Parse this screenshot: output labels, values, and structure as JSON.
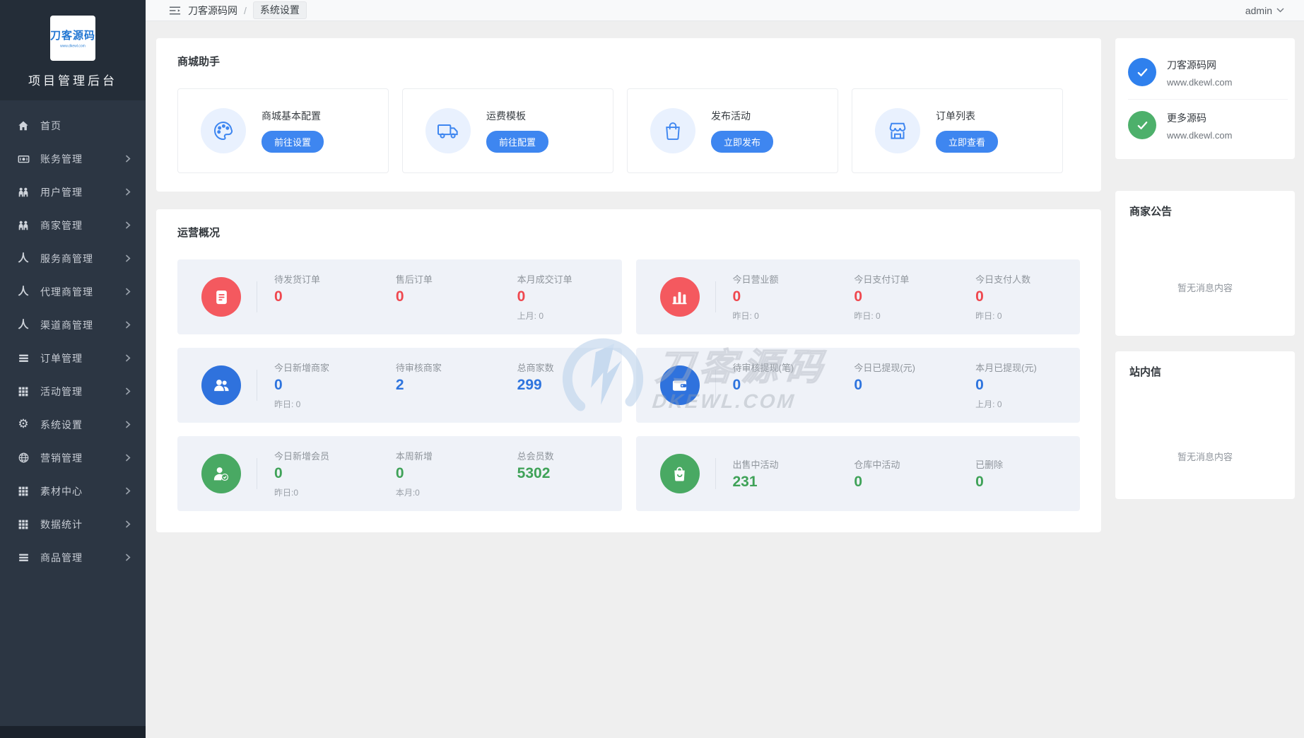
{
  "app": {
    "logo_title": "刀客源码",
    "logo_subtitle": "www.dkewl.com",
    "sidebar_title": "项目管理后台"
  },
  "topbar": {
    "breadcrumb": [
      "刀客源码网",
      "系统设置"
    ],
    "separator": "/",
    "user": "admin"
  },
  "sidebar": {
    "items": [
      {
        "id": "home",
        "label": "首页",
        "icon": "home-icon",
        "children": false
      },
      {
        "id": "finance",
        "label": "账务管理",
        "icon": "banknote-icon",
        "children": true
      },
      {
        "id": "users",
        "label": "用户管理",
        "icon": "users-icon",
        "children": true
      },
      {
        "id": "merchants",
        "label": "商家管理",
        "icon": "users-icon",
        "children": true
      },
      {
        "id": "service-providers",
        "label": "服务商管理",
        "icon": "person-icon",
        "children": true
      },
      {
        "id": "agents",
        "label": "代理商管理",
        "icon": "person-icon",
        "children": true
      },
      {
        "id": "channel-providers",
        "label": "渠道商管理",
        "icon": "person-icon",
        "children": true
      },
      {
        "id": "orders",
        "label": "订单管理",
        "icon": "list-icon",
        "children": true
      },
      {
        "id": "activities",
        "label": "活动管理",
        "icon": "grid-icon",
        "children": true
      },
      {
        "id": "system-settings",
        "label": "系统设置",
        "icon": "gear-icon",
        "children": true
      },
      {
        "id": "marketing",
        "label": "营销管理",
        "icon": "globe-icon",
        "children": true
      },
      {
        "id": "materials",
        "label": "素材中心",
        "icon": "grid-icon",
        "children": true
      },
      {
        "id": "statistics",
        "label": "数据统计",
        "icon": "grid-icon",
        "children": true
      },
      {
        "id": "goods",
        "label": "商品管理",
        "icon": "list-icon",
        "children": true
      }
    ]
  },
  "shop_helper": {
    "title": "商城助手",
    "items": [
      {
        "id": "shop-config",
        "label": "商城基本配置",
        "button": "前往设置",
        "icon": "palette-icon"
      },
      {
        "id": "freight-template",
        "label": "运费模板",
        "button": "前往配置",
        "icon": "truck-icon"
      },
      {
        "id": "publish-activity",
        "label": "发布活动",
        "button": "立即发布",
        "icon": "bag-icon"
      },
      {
        "id": "order-list",
        "label": "订单列表",
        "button": "立即查看",
        "icon": "store-icon"
      }
    ]
  },
  "overview": {
    "title": "运营概况",
    "panels": [
      {
        "id": "pending-orders",
        "accent": "red",
        "icon": "doc-icon",
        "stats": [
          {
            "label": "待发货订单",
            "value": "0"
          },
          {
            "label": "售后订单",
            "value": "0"
          },
          {
            "label": "本月成交订单",
            "value": "0",
            "sub": "上月: 0"
          }
        ]
      },
      {
        "id": "today-revenue",
        "accent": "red",
        "icon": "chart-icon",
        "stats": [
          {
            "label": "今日营业额",
            "value": "0",
            "sub": "昨日: 0"
          },
          {
            "label": "今日支付订单",
            "value": "0",
            "sub": "昨日: 0"
          },
          {
            "label": "今日支付人数",
            "value": "0",
            "sub": "昨日: 0"
          }
        ]
      },
      {
        "id": "merchant-stats",
        "accent": "blue",
        "icon": "users-white-icon",
        "stats": [
          {
            "label": "今日新增商家",
            "value": "0",
            "sub": "昨日: 0"
          },
          {
            "label": "待审核商家",
            "value": "2"
          },
          {
            "label": "总商家数",
            "value": "299"
          }
        ]
      },
      {
        "id": "withdraw-stats",
        "accent": "blue",
        "icon": "wallet-icon",
        "stats": [
          {
            "label": "待审核提现(笔)",
            "value": "0"
          },
          {
            "label": "今日已提现(元)",
            "value": "0"
          },
          {
            "label": "本月已提现(元)",
            "value": "0",
            "sub": "上月: 0"
          }
        ]
      },
      {
        "id": "member-stats",
        "accent": "green",
        "icon": "member-icon",
        "stats": [
          {
            "label": "今日新增会员",
            "value": "0",
            "sub": "昨日:0"
          },
          {
            "label": "本周新增",
            "value": "0",
            "sub": "本月:0"
          },
          {
            "label": "总会员数",
            "value": "5302"
          }
        ]
      },
      {
        "id": "activity-stats",
        "accent": "green",
        "icon": "bag-white-icon",
        "stats": [
          {
            "label": "出售中活动",
            "value": "231"
          },
          {
            "label": "仓库中活动",
            "value": "0"
          },
          {
            "label": "已删除",
            "value": "0"
          }
        ]
      }
    ]
  },
  "right_panel": {
    "links": [
      {
        "id": "main-site",
        "title": "刀客源码网",
        "url": "www.dkewl.com",
        "color": "blue"
      },
      {
        "id": "more-source",
        "title": "更多源码",
        "url": "www.dkewl.com",
        "color": "green"
      }
    ],
    "notice": {
      "title": "商家公告",
      "empty": "暂无消息内容"
    },
    "mail": {
      "title": "站内信",
      "empty": "暂无消息内容"
    }
  },
  "watermark": {
    "brand": "刀客源码",
    "domain": "DKEWL.COM"
  },
  "colors": {
    "accent_text": {
      "red": "#ef484f",
      "blue": "#2e74de",
      "green": "#3fa258"
    },
    "accent_circle": {
      "red": "#f4595f",
      "blue": "#2f72dd",
      "green": "#49a963"
    },
    "check_circle": {
      "blue": "#2f80ed",
      "green": "#4db06b"
    },
    "button_blue": "#3e86f0",
    "sidebar_bg": "#2c3643",
    "panel_bg": "#eff2f8"
  }
}
